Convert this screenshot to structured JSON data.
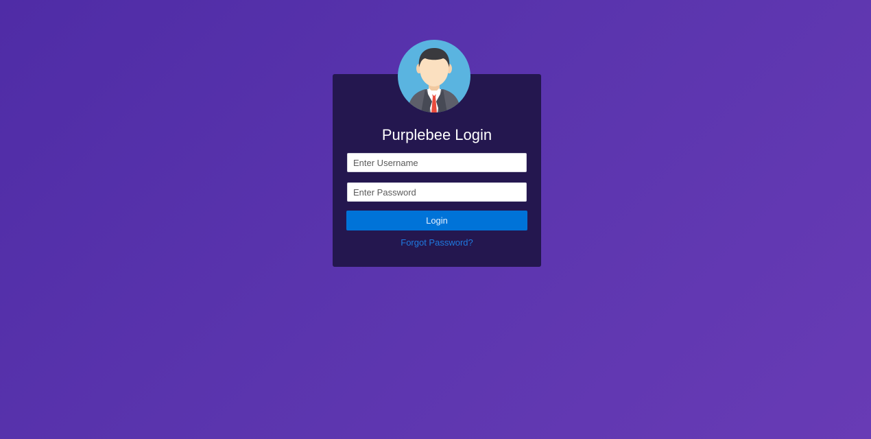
{
  "login": {
    "title": "Purplebee Login",
    "username_placeholder": "Enter Username",
    "password_placeholder": "Enter Password",
    "submit_label": "Login",
    "forgot_label": "Forgot Password?"
  },
  "avatar": {
    "icon": "user-avatar-icon",
    "background": "#5ab4e0"
  },
  "colors": {
    "background_gradient": [
      "#4f2ca6",
      "#683bb5"
    ],
    "card": "#24174f",
    "button": "#0073d8",
    "link": "#1e7ae0"
  }
}
